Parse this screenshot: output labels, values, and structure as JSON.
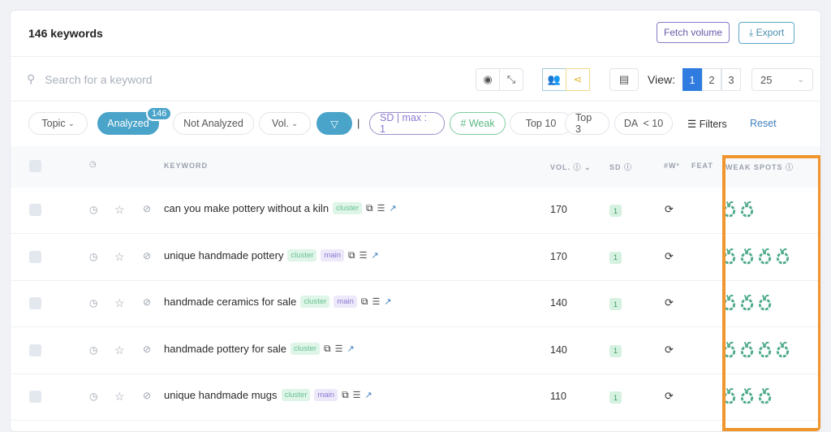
{
  "header": {
    "title": "146 keywords",
    "fetch_volume": "Fetch volume",
    "export": "Export"
  },
  "search": {
    "placeholder": "Search for a keyword"
  },
  "toolbar": {
    "view_label": "View:",
    "views": [
      "1",
      "2",
      "3"
    ],
    "active_view": "1",
    "per_page": "25"
  },
  "filters": {
    "topic": "Topic",
    "analyzed": "Analyzed",
    "analyzed_count": "146",
    "not_analyzed": "Not Analyzed",
    "vol": "Vol.",
    "sd": "SD | max : 1",
    "weak": "# Weak",
    "top10": "Top 10",
    "top3": "Top 3",
    "da": "DA  < 10",
    "filters": "Filters",
    "reset": "Reset",
    "separator": "|"
  },
  "table": {
    "columns": {
      "keyword": "KEYWORD",
      "vol": "VOL.",
      "sd": "SD",
      "w3": "#W³",
      "feat": "FEAT",
      "weak_spots": "WEAK SPOTS"
    },
    "rows": [
      {
        "keyword": "can you make pottery without a kiln",
        "tags": [
          "cluster"
        ],
        "vol": "170",
        "sd": "1",
        "weak_spots": 2
      },
      {
        "keyword": "unique handmade pottery",
        "tags": [
          "cluster",
          "main"
        ],
        "vol": "170",
        "sd": "1",
        "weak_spots": 4
      },
      {
        "keyword": "handmade ceramics for sale",
        "tags": [
          "cluster",
          "main"
        ],
        "vol": "140",
        "sd": "1",
        "weak_spots": 3
      },
      {
        "keyword": "handmade pottery for sale",
        "tags": [
          "cluster"
        ],
        "vol": "140",
        "sd": "1",
        "weak_spots": 4
      },
      {
        "keyword": "unique handmade mugs",
        "tags": [
          "cluster",
          "main"
        ],
        "vol": "110",
        "sd": "1",
        "weak_spots": 3
      }
    ]
  },
  "colors": {
    "accent": "#4aa3c9",
    "view_active": "#2f7be0",
    "highlight": "#f0962e",
    "weak_spot": "#4daa8a"
  }
}
